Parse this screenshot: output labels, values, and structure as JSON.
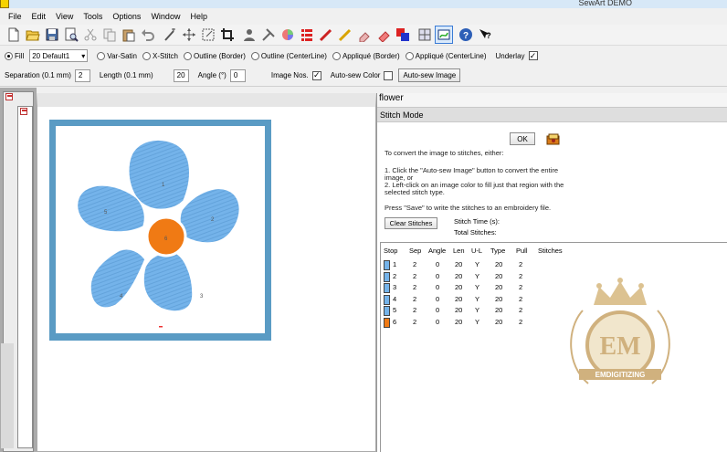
{
  "window": {
    "title": "SewArt DEMO"
  },
  "menu": [
    "File",
    "Edit",
    "View",
    "Tools",
    "Options",
    "Window",
    "Help"
  ],
  "toolbar": {
    "icons": [
      "new-file-icon",
      "open-folder-icon",
      "save-icon",
      "print-preview-icon",
      "cut-icon",
      "copy-icon",
      "paste-icon",
      "undo-icon",
      "wand-icon",
      "move-icon",
      "resize-icon",
      "crop-icon",
      "person-icon",
      "tools-icon",
      "color-wheel-icon",
      "palette-icon",
      "pen-icon",
      "pencil-icon",
      "eraser-icon",
      "fill-eraser-icon",
      "shapes-icon",
      "grid-icon",
      "embroidery-icon",
      "help-icon",
      "whats-this-icon"
    ]
  },
  "options": {
    "fill": "Fill",
    "preset": "20 Default1",
    "var_satin": "Var-Satin",
    "x_stitch": "X-Stitch",
    "outline_border": "Outline (Border)",
    "outline_centerline": "Outline (CenterLine)",
    "applique_border": "Appliqué (Border)",
    "applique_centerline": "Appliqué (CenterLine)",
    "underlay": "Underlay",
    "underlay_checked": "✓"
  },
  "params": {
    "separation_label": "Separation (0.1 mm)",
    "separation_value": "2",
    "length_label": "Length (0.1 mm)",
    "length_value": "20",
    "angle_label": "Angle (°)",
    "angle_value": "0",
    "image_nos_label": "Image Nos.",
    "image_nos_checked": "✓",
    "autosew_color_label": "Auto-sew Color",
    "autosew_image_button": "Auto-sew Image"
  },
  "canvas": {
    "petal_numbers": [
      "1",
      "2",
      "3",
      "4",
      "5"
    ],
    "center_number": "6",
    "petal_color": "#74b3ea",
    "center_color": "#f07a14",
    "hoop_color": "#5a9bc4"
  },
  "panel": {
    "title": "flower",
    "mode": "Stitch Mode",
    "ok": "OK",
    "instructions": [
      "To convert the image to stitches, either:",
      "1. Click the \"Auto-sew Image\" button to convert the entire",
      "image, or",
      "2. Left-click on an image color to fill just that region with the",
      "selected stitch type.",
      "Press \"Save\" to write the stitches to an embroidery file."
    ],
    "clear_stitches": "Clear Stitches",
    "stitch_time": "Stitch Time (s):",
    "total_stitches": "Total Stitches:"
  },
  "table": {
    "headers": [
      "Stop",
      "Sep",
      "Angle",
      "Len",
      "U-L",
      "Type",
      "Pull",
      "Stitches"
    ],
    "rows": [
      {
        "stop": "1",
        "sep": "2",
        "angle": "0",
        "len": "20",
        "ul": "Y",
        "type": "20",
        "pull": "2",
        "color": "#74b3ea"
      },
      {
        "stop": "2",
        "sep": "2",
        "angle": "0",
        "len": "20",
        "ul": "Y",
        "type": "20",
        "pull": "2",
        "color": "#74b3ea"
      },
      {
        "stop": "3",
        "sep": "2",
        "angle": "0",
        "len": "20",
        "ul": "Y",
        "type": "20",
        "pull": "2",
        "color": "#74b3ea"
      },
      {
        "stop": "4",
        "sep": "2",
        "angle": "0",
        "len": "20",
        "ul": "Y",
        "type": "20",
        "pull": "2",
        "color": "#74b3ea"
      },
      {
        "stop": "5",
        "sep": "2",
        "angle": "0",
        "len": "20",
        "ul": "Y",
        "type": "20",
        "pull": "2",
        "color": "#74b3ea"
      },
      {
        "stop": "6",
        "sep": "2",
        "angle": "0",
        "len": "20",
        "ul": "Y",
        "type": "20",
        "pull": "2",
        "color": "#f07a14"
      }
    ]
  },
  "watermark": {
    "monogram": "EM",
    "banner": "EMDIGITIZING"
  }
}
